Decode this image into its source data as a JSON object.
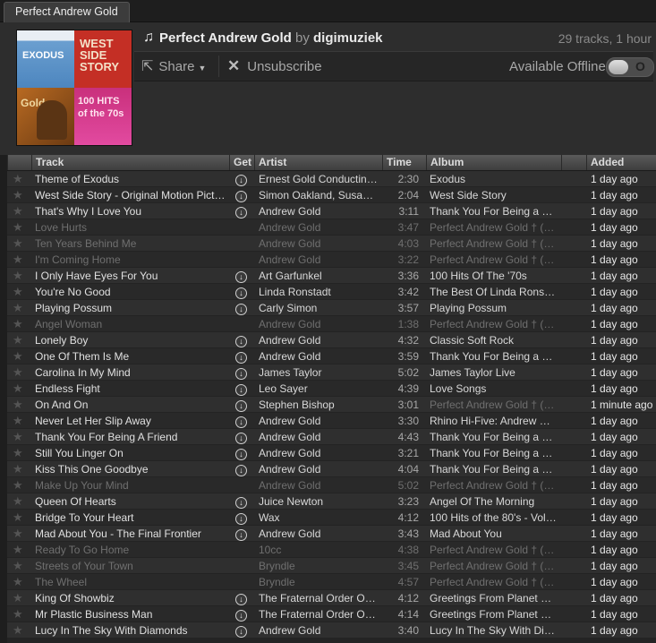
{
  "tab": {
    "label": "Perfect Andrew Gold"
  },
  "playlist": {
    "title": "Perfect Andrew Gold",
    "by": "by",
    "owner": "digimuziek",
    "stats": "29 tracks, 1 hour",
    "share_label": "Share",
    "unsubscribe_label": "Unsubscribe",
    "offline_label": "Available Offline",
    "offline_toggle": "O",
    "mosaic": [
      {
        "word": "EXODUS",
        "fg": "#ffffff"
      },
      {
        "word": "WEST SIDE STORY",
        "fg": "#f4e2c9"
      },
      {
        "word": "Gold",
        "fg": "#f0d8a0"
      },
      {
        "word": "100 HITS of the 70s",
        "fg": "#ffe4ef"
      }
    ]
  },
  "columns": {
    "track": "Track",
    "get": "Get",
    "artist": "Artist",
    "time": "Time",
    "album": "Album",
    "added": "Added"
  },
  "colors": {
    "accent": "#e0e0e0",
    "disabled": "#6f6f6f"
  },
  "rows": [
    {
      "track": "Theme of Exodus",
      "get": true,
      "artist": "Ernest Gold Conducting T...",
      "time": "2:30",
      "album": "Exodus",
      "added": "1 day ago",
      "disabled": false
    },
    {
      "track": "West Side Story - Original Motion Picture S...",
      "get": true,
      "artist": "Simon Oakland, Susan O...",
      "time": "2:04",
      "album": "West Side Story",
      "added": "1 day ago",
      "disabled": false
    },
    {
      "track": "That's Why I Love You",
      "get": true,
      "artist": "Andrew Gold",
      "time": "3:11",
      "album": "Thank You For Being a Frie...",
      "added": "1 day ago",
      "disabled": false
    },
    {
      "track": "Love Hurts",
      "get": false,
      "artist": "Andrew Gold",
      "time": "3:47",
      "album": "Perfect Andrew Gold † (acc...",
      "added": "1 day ago",
      "disabled": true
    },
    {
      "track": "Ten Years Behind Me",
      "get": false,
      "artist": "Andrew Gold",
      "time": "4:03",
      "album": "Perfect Andrew Gold † (acc...",
      "added": "1 day ago",
      "disabled": true
    },
    {
      "track": "I'm Coming Home",
      "get": false,
      "artist": "Andrew Gold",
      "time": "3:22",
      "album": "Perfect Andrew Gold † (acc...",
      "added": "1 day ago",
      "disabled": true
    },
    {
      "track": "I Only Have Eyes For You",
      "get": true,
      "artist": "Art Garfunkel",
      "time": "3:36",
      "album": "100 Hits Of The '70s",
      "added": "1 day ago",
      "disabled": false
    },
    {
      "track": "You're No Good",
      "get": true,
      "artist": "Linda Ronstadt",
      "time": "3:42",
      "album": "The Best Of Linda Ronstad...",
      "added": "1 day ago",
      "disabled": false
    },
    {
      "track": "Playing Possum",
      "get": true,
      "artist": "Carly Simon",
      "time": "3:57",
      "album": "Playing Possum",
      "added": "1 day ago",
      "disabled": false
    },
    {
      "track": "Angel Woman",
      "get": false,
      "artist": "Andrew Gold",
      "time": "1:38",
      "album": "Perfect Andrew Gold † (acc...",
      "added": "1 day ago",
      "disabled": true
    },
    {
      "track": "Lonely Boy",
      "get": true,
      "artist": "Andrew Gold",
      "time": "4:32",
      "album": "Classic Soft Rock",
      "added": "1 day ago",
      "disabled": false
    },
    {
      "track": "One Of Them Is Me",
      "get": true,
      "artist": "Andrew Gold",
      "time": "3:59",
      "album": "Thank You For Being a Frie...",
      "added": "1 day ago",
      "disabled": false
    },
    {
      "track": "Carolina In My Mind",
      "get": true,
      "artist": "James Taylor",
      "time": "5:02",
      "album": "James Taylor Live",
      "added": "1 day ago",
      "disabled": false
    },
    {
      "track": "Endless Fight",
      "get": true,
      "artist": "Leo Sayer",
      "time": "4:39",
      "album": "Love Songs",
      "added": "1 day ago",
      "disabled": false
    },
    {
      "track": "On And On",
      "get": true,
      "artist": "Stephen Bishop",
      "time": "3:01",
      "album": "Perfect Andrew Gold † (acc...",
      "added": "1 minute ago",
      "disabled": false,
      "album_dim": true
    },
    {
      "track": "Never Let Her Slip Away",
      "get": true,
      "artist": "Andrew Gold",
      "time": "3:30",
      "album": "Rhino Hi-Five: Andrew Gold",
      "added": "1 day ago",
      "disabled": false
    },
    {
      "track": "Thank You For Being A Friend",
      "get": true,
      "artist": "Andrew Gold",
      "time": "4:43",
      "album": "Thank You For Being a Frie...",
      "added": "1 day ago",
      "disabled": false
    },
    {
      "track": "Still You Linger On",
      "get": true,
      "artist": "Andrew Gold",
      "time": "3:21",
      "album": "Thank You For Being a Frie...",
      "added": "1 day ago",
      "disabled": false
    },
    {
      "track": "Kiss This One Goodbye",
      "get": true,
      "artist": "Andrew Gold",
      "time": "4:04",
      "album": "Thank You For Being a Frie...",
      "added": "1 day ago",
      "disabled": false
    },
    {
      "track": "Make Up Your Mind",
      "get": false,
      "artist": "Andrew Gold",
      "time": "5:02",
      "album": "Perfect Andrew Gold † (acc...",
      "added": "1 day ago",
      "disabled": true
    },
    {
      "track": "Queen Of Hearts",
      "get": true,
      "artist": "Juice Newton",
      "time": "3:23",
      "album": "Angel Of The Morning",
      "added": "1 day ago",
      "disabled": false
    },
    {
      "track": "Bridge To Your Heart",
      "get": true,
      "artist": "Wax",
      "time": "4:12",
      "album": "100 Hits of the 80's - Volum...",
      "added": "1 day ago",
      "disabled": false
    },
    {
      "track": "Mad About You - The Final Frontier",
      "get": true,
      "artist": "Andrew Gold",
      "time": "3:43",
      "album": "Mad About You",
      "added": "1 day ago",
      "disabled": false
    },
    {
      "track": "Ready To Go Home",
      "get": false,
      "artist": "10cc",
      "time": "4:38",
      "album": "Perfect Andrew Gold † (acc...",
      "added": "1 day ago",
      "disabled": true
    },
    {
      "track": "Streets of Your Town",
      "get": false,
      "artist": "Bryndle",
      "time": "3:45",
      "album": "Perfect Andrew Gold † (acc...",
      "added": "1 day ago",
      "disabled": true
    },
    {
      "track": "The Wheel",
      "get": false,
      "artist": "Bryndle",
      "time": "4:57",
      "album": "Perfect Andrew Gold † (acc...",
      "added": "1 day ago",
      "disabled": true
    },
    {
      "track": "King Of Showbiz",
      "get": true,
      "artist": "The Fraternal Order Of T...",
      "time": "4:12",
      "album": "Greetings From Planet Love",
      "added": "1 day ago",
      "disabled": false
    },
    {
      "track": "Mr Plastic Business Man",
      "get": true,
      "artist": "The Fraternal Order Of T...",
      "time": "4:14",
      "album": "Greetings From Planet Love",
      "added": "1 day ago",
      "disabled": false
    },
    {
      "track": "Lucy In The Sky With Diamonds",
      "get": true,
      "artist": "Andrew Gold",
      "time": "3:40",
      "album": "Lucy In The Sky With Diam...",
      "added": "1 day ago",
      "disabled": false
    }
  ]
}
